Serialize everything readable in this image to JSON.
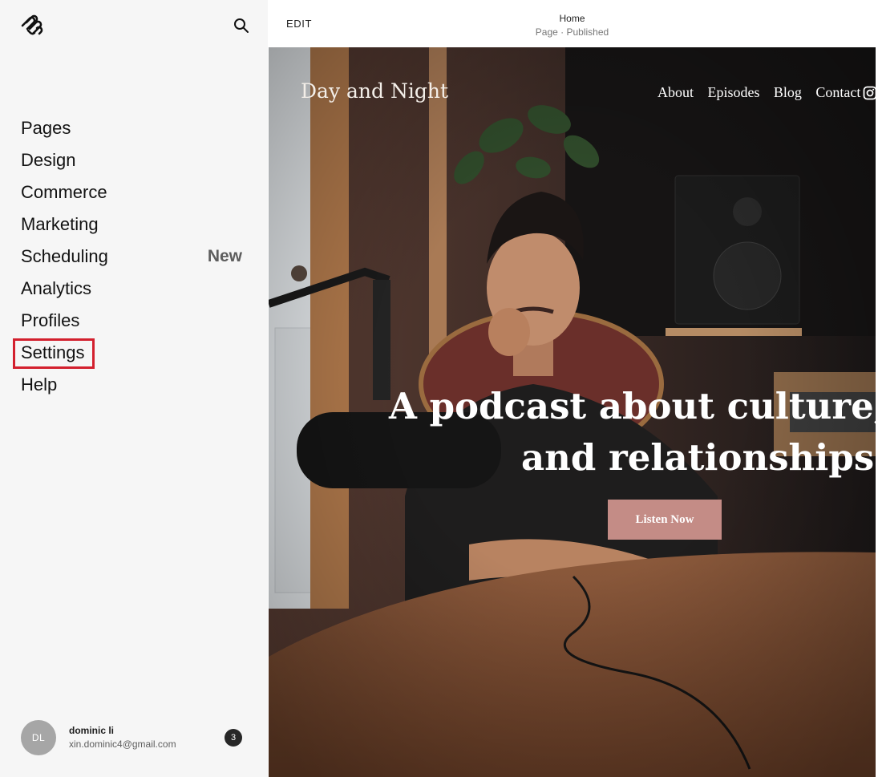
{
  "sidebar": {
    "nav": [
      {
        "label": "Pages"
      },
      {
        "label": "Design"
      },
      {
        "label": "Commerce"
      },
      {
        "label": "Marketing"
      },
      {
        "label": "Scheduling",
        "badge": "New"
      },
      {
        "label": "Analytics"
      },
      {
        "label": "Profiles"
      },
      {
        "label": "Settings",
        "highlighted": true
      },
      {
        "label": "Help"
      }
    ],
    "account": {
      "initials": "DL",
      "name": "dominic li",
      "email": "xin.dominic4@gmail.com",
      "notifications": "3"
    }
  },
  "editor": {
    "edit_label": "EDIT",
    "page_title": "Home",
    "page_status": "Page · Published"
  },
  "site": {
    "title": "Day and Night",
    "nav": [
      "About",
      "Episodes",
      "Blog",
      "Contact"
    ],
    "headline_line1": "A podcast about culture, trav",
    "headline_line2": "and relationships.",
    "cta_label": "Listen Now"
  },
  "colors": {
    "sidebar_bg": "#f6f6f6",
    "highlight_box": "#d3202e",
    "cta_bg": "#c48c86"
  }
}
